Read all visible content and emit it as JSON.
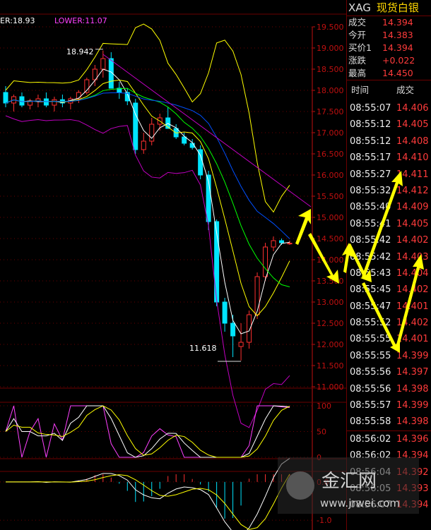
{
  "chart_data": {
    "type": "candlestick",
    "indicator_label": "ER:18.93",
    "indicator_label2": "LOWER:11.07",
    "price_ticks": [
      "19.500",
      "19.000",
      "18.500",
      "18.000",
      "17.500",
      "17.000",
      "16.500",
      "16.000",
      "15.500",
      "15.000",
      "14.500",
      "14.000",
      "13.500",
      "13.000",
      "12.500",
      "12.000",
      "11.500",
      "11.000"
    ],
    "ylim": [
      11.0,
      19.5
    ],
    "annotations": {
      "high": "18.942",
      "low": "11.618"
    },
    "candles": [
      [
        17.95,
        18.1,
        17.6,
        17.7
      ],
      [
        17.7,
        17.9,
        17.5,
        17.85
      ],
      [
        17.85,
        17.95,
        17.6,
        17.65
      ],
      [
        17.65,
        17.8,
        17.55,
        17.75
      ],
      [
        17.75,
        17.9,
        17.6,
        17.8
      ],
      [
        17.8,
        17.95,
        17.6,
        17.65
      ],
      [
        17.65,
        17.85,
        17.5,
        17.78
      ],
      [
        17.78,
        17.9,
        17.6,
        17.7
      ],
      [
        17.7,
        17.85,
        17.55,
        17.8
      ],
      [
        17.8,
        18.0,
        17.7,
        17.95
      ],
      [
        17.95,
        18.3,
        17.9,
        18.25
      ],
      [
        18.25,
        18.6,
        18.1,
        18.5
      ],
      [
        18.5,
        18.94,
        18.3,
        18.75
      ],
      [
        18.75,
        18.9,
        18.1,
        18.05
      ],
      [
        18.05,
        18.2,
        17.8,
        17.95
      ],
      [
        17.95,
        18.05,
        17.65,
        17.75
      ],
      [
        17.7,
        17.8,
        16.5,
        16.6
      ],
      [
        16.6,
        17.0,
        16.5,
        16.8
      ],
      [
        16.8,
        17.35,
        16.7,
        17.2
      ],
      [
        17.2,
        17.45,
        17.05,
        17.35
      ],
      [
        17.35,
        17.6,
        17.25,
        17.1
      ],
      [
        17.1,
        17.2,
        16.85,
        16.9
      ],
      [
        16.9,
        17.0,
        16.7,
        16.75
      ],
      [
        16.75,
        16.85,
        16.6,
        16.65
      ],
      [
        16.6,
        16.7,
        15.9,
        16.0
      ],
      [
        16.0,
        16.1,
        14.7,
        14.9
      ],
      [
        14.9,
        14.95,
        12.9,
        13.0
      ],
      [
        13.0,
        13.1,
        12.3,
        12.5
      ],
      [
        12.5,
        12.7,
        11.7,
        12.2
      ],
      [
        11.95,
        12.5,
        11.62,
        12.05
      ],
      [
        12.05,
        12.8,
        11.9,
        12.7
      ],
      [
        12.7,
        13.7,
        12.6,
        13.6
      ],
      [
        13.6,
        14.4,
        13.5,
        14.3
      ],
      [
        14.3,
        14.55,
        14.2,
        14.45
      ],
      [
        14.45,
        14.5,
        14.35,
        14.4
      ],
      [
        14.39,
        14.45,
        14.35,
        14.39
      ]
    ],
    "osc_ticks": [
      "100",
      "50",
      "0"
    ],
    "osc_ylim": [
      0,
      100
    ],
    "macd_ticks": [
      "0.0",
      "-1.0"
    ],
    "macd_ylim": [
      -1.2,
      0.2
    ],
    "colors": {
      "up": "#ff3030",
      "down": "#00e5ff",
      "ma1": "#ffffff",
      "ma2": "#ffff00",
      "ma3": "#00ff00",
      "ma4": "#0050ff",
      "ma5": "#c000c0",
      "grid": "#6c0000",
      "axis": "#c01010"
    }
  },
  "panel": {
    "symbol": "XAG",
    "name": "现货白银",
    "quotes": [
      {
        "k": "成交",
        "v": "14.394"
      },
      {
        "k": "今开",
        "v": "14.383"
      },
      {
        "k": "买价1",
        "v": "14.394"
      },
      {
        "k": "涨跌",
        "v": "+0.022"
      },
      {
        "k": "最高",
        "v": "14.450"
      }
    ],
    "col_time": "时间",
    "col_deal": "成交",
    "ticks": [
      {
        "t": "08:55:07",
        "p": "14.406"
      },
      {
        "t": "08:55:12",
        "p": "14.405"
      },
      {
        "t": "08:55:12",
        "p": "14.408"
      },
      {
        "t": "08:55:17",
        "p": "14.410"
      },
      {
        "t": "08:55:27",
        "p": "14.411"
      },
      {
        "t": "08:55:32",
        "p": "14.412"
      },
      {
        "t": "08:55:40",
        "p": "14.409"
      },
      {
        "t": "08:55:41",
        "p": "14.405"
      },
      {
        "t": "08:55:42",
        "p": "14.402"
      },
      {
        "t": "08:55:42",
        "p": "14.403"
      },
      {
        "t": "08:55:43",
        "p": "14.404"
      },
      {
        "t": "08:55:45",
        "p": "14.402"
      },
      {
        "t": "08:55:47",
        "p": "14.401"
      },
      {
        "t": "08:55:52",
        "p": "14.402"
      },
      {
        "t": "08:55:55",
        "p": "14.401"
      },
      {
        "t": "08:55:55",
        "p": "14.399"
      },
      {
        "t": "08:55:56",
        "p": "14.397"
      },
      {
        "t": "08:55:56",
        "p": "14.398"
      },
      {
        "t": "08:55:57",
        "p": "14.399"
      },
      {
        "t": "08:55:58",
        "p": "14.398"
      },
      {
        "t": "08:56:02",
        "p": "14.396"
      },
      {
        "t": "08:56:02",
        "p": "14.394"
      },
      {
        "t": "08:56:04",
        "p": "14.392"
      },
      {
        "t": "08:56:05",
        "p": "14.393"
      },
      {
        "t": "08:56:07",
        "p": "14.394"
      }
    ]
  },
  "watermark": {
    "brand": "金汇网",
    "url": "www.jrwei.com"
  }
}
